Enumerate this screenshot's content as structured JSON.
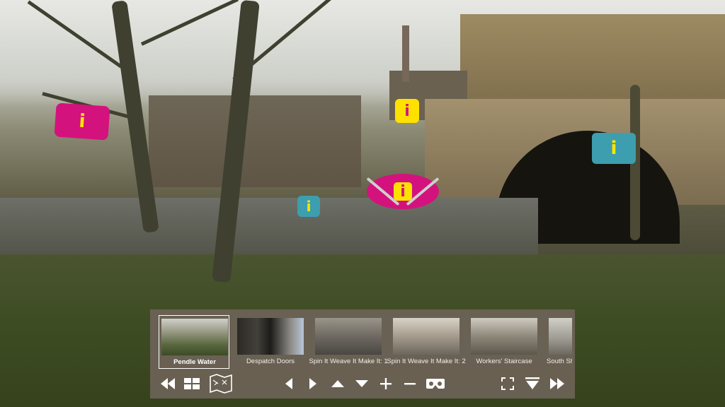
{
  "hotspots": [
    {
      "name": "info-hotspot-left",
      "glyph": "i",
      "style": "magenta"
    },
    {
      "name": "info-hotspot-building",
      "glyph": "i",
      "style": "yellow"
    },
    {
      "name": "info-hotspot-active",
      "glyph": "i",
      "style": "active"
    },
    {
      "name": "info-hotspot-river",
      "glyph": "i",
      "style": "teal"
    },
    {
      "name": "info-hotspot-bridge",
      "glyph": "i",
      "style": "teal"
    }
  ],
  "tour": {
    "thumbnails": [
      {
        "label": "Pendle Water",
        "active": true
      },
      {
        "label": "Despatch Doors",
        "active": false
      },
      {
        "label": "Spin It Weave It Make It: 1",
        "active": false
      },
      {
        "label": "Spin It Weave It Make It: 2",
        "active": false
      },
      {
        "label": "Workers' Staircase",
        "active": false
      },
      {
        "label": "South Sh",
        "active": false
      }
    ]
  },
  "controls": {
    "left_group": [
      "rewind-icon",
      "grid-icon",
      "map-icon"
    ],
    "center_group": [
      "arrow-left-icon",
      "arrow-right-icon",
      "arrow-up-icon",
      "arrow-down-icon",
      "plus-icon",
      "minus-icon",
      "vr-headset-icon"
    ],
    "right_group": [
      "fullscreen-icon",
      "hide-bar-icon",
      "fast-forward-icon"
    ]
  },
  "colors": {
    "accent_magenta": "#d4127d",
    "accent_yellow": "#ffe100",
    "accent_teal": "#3c9eae",
    "bar_background": "#70645a"
  }
}
